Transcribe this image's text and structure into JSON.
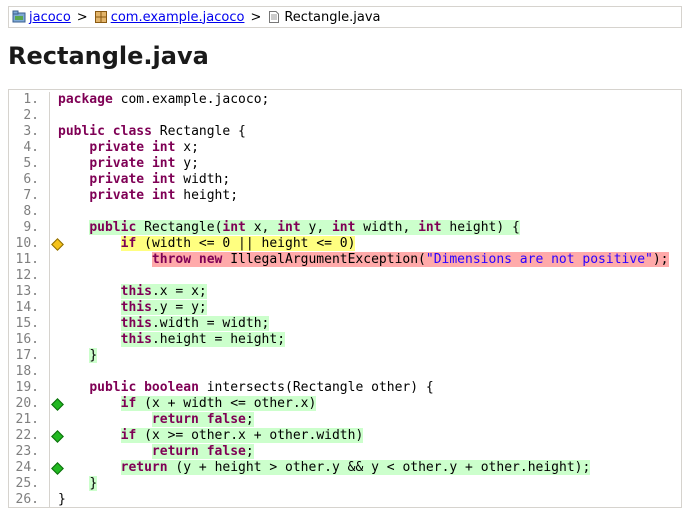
{
  "breadcrumb": [
    {
      "label": "jacoco",
      "icon": "project-icon"
    },
    {
      "label": "com.example.jacoco",
      "icon": "package-icon"
    },
    {
      "label": "Rectangle.java",
      "icon": "file-icon"
    }
  ],
  "separator": ">",
  "page_title": "Rectangle.java",
  "code_lines": [
    {
      "n": "1.",
      "status": "none",
      "branch": "none",
      "text": "package com.example.jacoco;"
    },
    {
      "n": "2.",
      "status": "none",
      "branch": "none",
      "text": ""
    },
    {
      "n": "3.",
      "status": "none",
      "branch": "none",
      "text": "public class Rectangle {"
    },
    {
      "n": "4.",
      "status": "none",
      "branch": "none",
      "text": "    private int x;"
    },
    {
      "n": "5.",
      "status": "none",
      "branch": "none",
      "text": "    private int y;"
    },
    {
      "n": "6.",
      "status": "none",
      "branch": "none",
      "text": "    private int width;"
    },
    {
      "n": "7.",
      "status": "none",
      "branch": "none",
      "text": "    private int height;"
    },
    {
      "n": "8.",
      "status": "none",
      "branch": "none",
      "text": ""
    },
    {
      "n": "9.",
      "status": "covered",
      "branch": "none",
      "text": "    public Rectangle(int x, int y, int width, int height) {"
    },
    {
      "n": "10.",
      "status": "partial",
      "branch": "partial",
      "text": "        if (width <= 0 || height <= 0)"
    },
    {
      "n": "11.",
      "status": "missed",
      "branch": "none",
      "text": "            throw new IllegalArgumentException(\"Dimensions are not positive\");"
    },
    {
      "n": "12.",
      "status": "none",
      "branch": "none",
      "text": ""
    },
    {
      "n": "13.",
      "status": "covered",
      "branch": "none",
      "text": "        this.x = x;"
    },
    {
      "n": "14.",
      "status": "covered",
      "branch": "none",
      "text": "        this.y = y;"
    },
    {
      "n": "15.",
      "status": "covered",
      "branch": "none",
      "text": "        this.width = width;"
    },
    {
      "n": "16.",
      "status": "covered",
      "branch": "none",
      "text": "        this.height = height;"
    },
    {
      "n": "17.",
      "status": "covered",
      "branch": "none",
      "text": "    }"
    },
    {
      "n": "18.",
      "status": "none",
      "branch": "none",
      "text": ""
    },
    {
      "n": "19.",
      "status": "none",
      "branch": "none",
      "text": "    public boolean intersects(Rectangle other) {"
    },
    {
      "n": "20.",
      "status": "covered",
      "branch": "full",
      "text": "        if (x + width <= other.x)"
    },
    {
      "n": "21.",
      "status": "covered",
      "branch": "none",
      "text": "            return false;"
    },
    {
      "n": "22.",
      "status": "covered",
      "branch": "full",
      "text": "        if (x >= other.x + other.width)"
    },
    {
      "n": "23.",
      "status": "covered",
      "branch": "none",
      "text": "            return false;"
    },
    {
      "n": "24.",
      "status": "covered",
      "branch": "full",
      "text": "        return (y + height > other.y && y < other.y + other.height);"
    },
    {
      "n": "25.",
      "status": "covered",
      "branch": "none",
      "text": "    }"
    },
    {
      "n": "26.",
      "status": "none",
      "branch": "none",
      "text": "}"
    }
  ],
  "colors": {
    "covered": "#ccffcc",
    "missed": "#ffaaaa",
    "partial": "#ffff80",
    "keyword": "#7f0055",
    "string": "#2a00ff",
    "link": "#0000ee"
  }
}
